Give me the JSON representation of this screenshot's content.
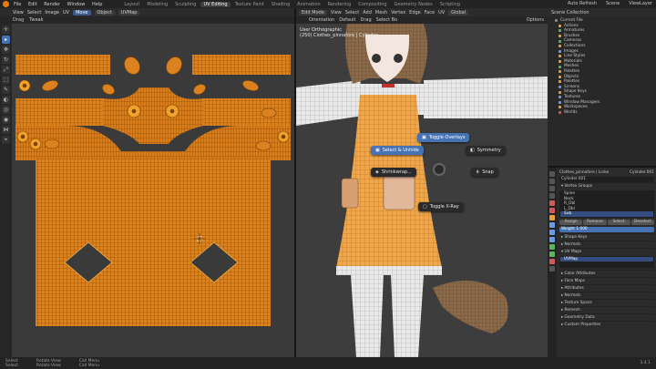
{
  "topbar": {
    "menus": [
      "File",
      "Edit",
      "Render",
      "Window",
      "Help"
    ],
    "workspaces": [
      "Layout",
      "Modeling",
      "Sculpting",
      "UV Editing",
      "Texture Paint",
      "Shading",
      "Animation",
      "Rendering",
      "Compositing",
      "Geometry Nodes",
      "Scripting"
    ],
    "active_workspace": "UV Editing",
    "right_items": [
      "Auto Refresh",
      "Scene",
      "ViewLayer"
    ]
  },
  "uv_editor": {
    "header": [
      "View",
      "Select",
      "Image",
      "UV"
    ],
    "mode_btn": "Move",
    "image_btn": "Object",
    "image_name": "UVMap",
    "sub": [
      "Drag",
      "Tweak"
    ],
    "tools": [
      "cursor-icon",
      "select-icon",
      "move-icon",
      "rotate-icon",
      "scale-icon",
      "transform-icon",
      "annotate-icon",
      "grab-icon",
      "relax-icon",
      "pinch-icon",
      "rip-icon",
      "sample-icon"
    ]
  },
  "viewport": {
    "header": [
      "Edit Mode",
      "View",
      "Select",
      "Add",
      "Mesh",
      "Vertex",
      "Edge",
      "Face",
      "UV"
    ],
    "sub": [
      "Orientation",
      "Default",
      "Drag",
      "Select Bo"
    ],
    "global_label": "Global",
    "options_label": "Options",
    "info_line1": "User Orthographic",
    "info_line2": "(250) Clothes_pinnafore | Cylinder",
    "pie": {
      "top": "Toggle Overlays",
      "upper_left": "Select & Unhide",
      "upper_right": "Symmetry",
      "left": "Shrinkwrap...",
      "right": "Snap",
      "lower_right": "Toggle X-Ray"
    }
  },
  "outliner": {
    "header": "Scene Collection",
    "rows": [
      {
        "label": "Current File",
        "c": ""
      },
      {
        "label": "Actions",
        "c": "o"
      },
      {
        "label": "Armatures",
        "c": "g"
      },
      {
        "label": "Brushes",
        "c": "o"
      },
      {
        "label": "Cameras",
        "c": "g"
      },
      {
        "label": "Collections",
        "c": "o"
      },
      {
        "label": "Images",
        "c": "b"
      },
      {
        "label": "Line Styles",
        "c": "o"
      },
      {
        "label": "Materials",
        "c": "o"
      },
      {
        "label": "Meshes",
        "c": "g"
      },
      {
        "label": "Palettes",
        "c": "o"
      },
      {
        "label": "Objects",
        "c": "o"
      },
      {
        "label": "Palettes",
        "c": "o"
      },
      {
        "label": "Screens",
        "c": "b"
      },
      {
        "label": "Shape Keys",
        "c": "o"
      },
      {
        "label": "Textures",
        "c": "b"
      },
      {
        "label": "Window Managers",
        "c": "b"
      },
      {
        "label": "Workspaces",
        "c": "o"
      },
      {
        "label": "Worlds",
        "c": "r"
      }
    ]
  },
  "properties": {
    "object_name": "Clothes_pinnafore | Linke",
    "mesh_name": "Cylinder.001",
    "data_name": "Cylinder.001",
    "vertex_groups_title": "Vertex Groups",
    "vertex_groups": [
      "Spine",
      "Neck",
      "R_Dbl",
      "L_Dbl",
      "Sub"
    ],
    "selected_vg": "Sub",
    "shape_keys_buttons": [
      "Assign",
      "Remove",
      "Select",
      "Deselect"
    ],
    "weight_label": "Weight",
    "weight_value": "1.000",
    "shape_keys_title": "Shape Keys",
    "face_normals_title": "Normals",
    "uv_maps_title": "UV Maps",
    "uv_map": "UVMap",
    "more_sections": [
      "Color Attributes",
      "Face Maps",
      "Attributes",
      "Normals",
      "Texture Space",
      "Remesh",
      "Geometry Data",
      "Custom Properties"
    ]
  },
  "statusbar": {
    "items": [
      [
        "Select",
        "Rotate View",
        "Call Menu"
      ],
      [
        "Select",
        "Rotate View",
        "Call Menu"
      ]
    ],
    "version": "3.4.1"
  },
  "colors": {
    "accent": "#4772b3",
    "uv_orange": "#e8a03c",
    "blender_orange": "#e87d0d"
  }
}
